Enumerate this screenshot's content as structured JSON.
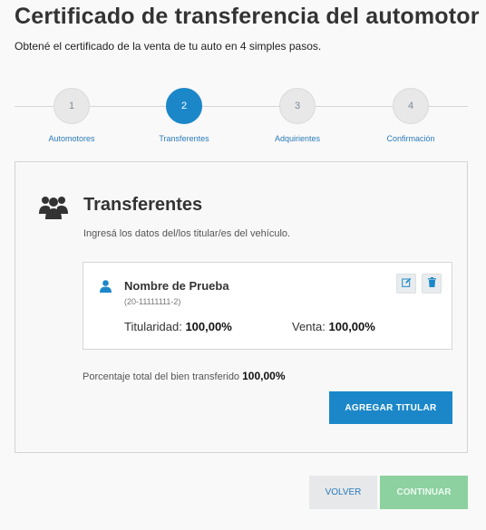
{
  "header": {
    "title": "Certificado de transferencia del automotor",
    "subtitle": "Obtené el certificado de la venta de tu auto en 4 simples pasos."
  },
  "stepper": {
    "steps": [
      {
        "number": "1",
        "label": "Automotores",
        "active": false
      },
      {
        "number": "2",
        "label": "Transferentes",
        "active": true
      },
      {
        "number": "3",
        "label": "Adquirientes",
        "active": false
      },
      {
        "number": "4",
        "label": "Confirmación",
        "active": false
      }
    ]
  },
  "panel": {
    "icon": "users-icon",
    "title": "Transferentes",
    "description": "Ingresá los datos del/los titular/es del vehículo."
  },
  "holder": {
    "icon": "user-icon",
    "name": "Nombre de Prueba",
    "id": "(20-11111111-2)",
    "titularidad_label": "Titularidad:",
    "titularidad_value": "100,00%",
    "venta_label": "Venta:",
    "venta_value": "100,00%",
    "edit_icon": "edit-icon",
    "delete_icon": "trash-icon"
  },
  "total": {
    "label": "Porcentaje total del bien transferido",
    "value": "100,00%"
  },
  "buttons": {
    "add_label": "AGREGAR TITULAR",
    "back_label": "VOLVER",
    "next_label": "CONTINUAR"
  },
  "colors": {
    "primary": "#1b87c9",
    "continue_disabled": "#8cd19f",
    "link": "#2b7bb9"
  }
}
